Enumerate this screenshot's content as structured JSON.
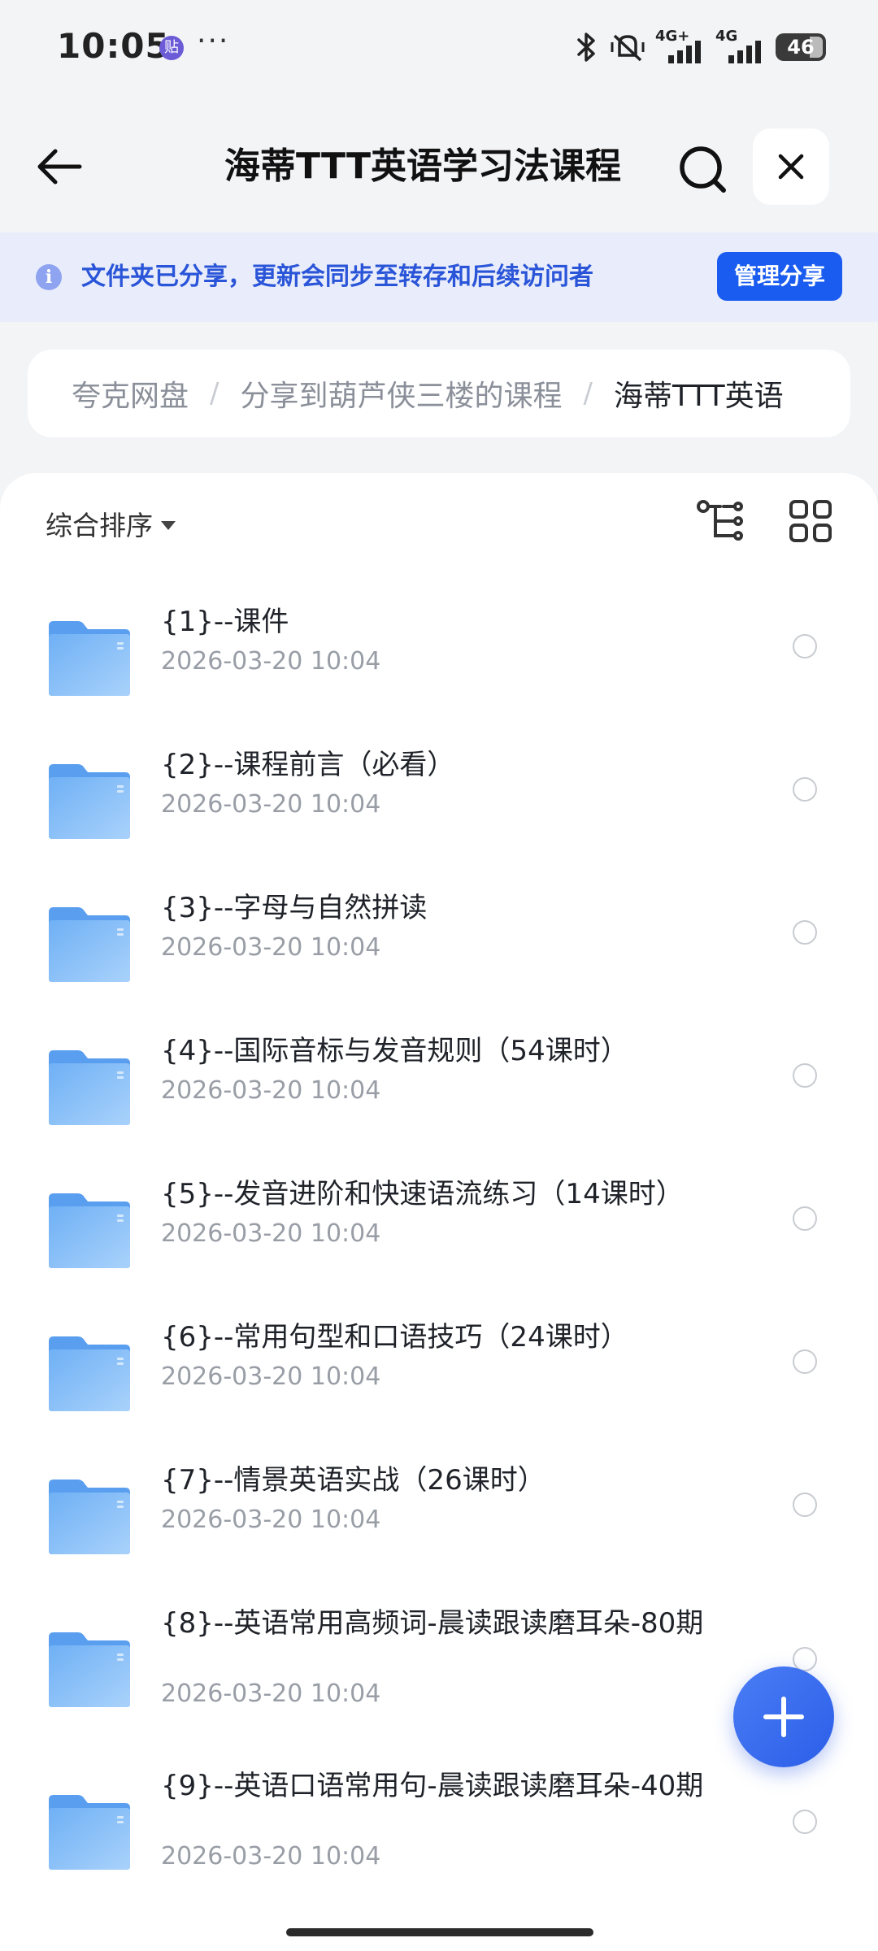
{
  "status_bar": {
    "time": "10:05",
    "app_badge": "贴",
    "overflow": "···",
    "network_1": "4G+",
    "network_2": "4G",
    "battery": "46"
  },
  "header": {
    "title": "海蒂TTT英语学习法课程",
    "icons": [
      "back-arrow-icon",
      "search-icon",
      "close-icon"
    ]
  },
  "banner": {
    "text": "文件夹已分享，更新会同步至转存和后续访问者",
    "button": "管理分享",
    "info_glyph": "i"
  },
  "breadcrumb": {
    "items": [
      "夸克网盘",
      "分享到葫芦侠三楼的课程",
      "海蒂TTT英语"
    ],
    "separator": "/"
  },
  "toolbar": {
    "sort_label": "综合排序"
  },
  "files": [
    {
      "name": "{1}--课件",
      "date": "2026-03-20 10:04"
    },
    {
      "name": "{2}--课程前言（必看）",
      "date": "2026-03-20 10:04"
    },
    {
      "name": "{3}--字母与自然拼读",
      "date": "2026-03-20 10:04"
    },
    {
      "name": "{4}--国际音标与发音规则（54课时）",
      "date": "2026-03-20 10:04"
    },
    {
      "name": "{5}--发音进阶和快速语流练习（14课时）",
      "date": "2026-03-20 10:04"
    },
    {
      "name": "{6}--常用句型和口语技巧（24课时）",
      "date": "2026-03-20 10:04"
    },
    {
      "name": "{7}--情景英语实战（26课时）",
      "date": "2026-03-20 10:04"
    },
    {
      "name": "{8}--英语常用高频词-晨读跟读磨耳朵-80期",
      "date": "2026-03-20 10:04"
    },
    {
      "name": "{9}--英语口语常用句-晨读跟读磨耳朵-40期",
      "date": "2026-03-20 10:04"
    }
  ],
  "colors": {
    "accent": "#1a5cf0",
    "banner_bg": "#e9edfb",
    "folder": "#6aa9f2"
  }
}
